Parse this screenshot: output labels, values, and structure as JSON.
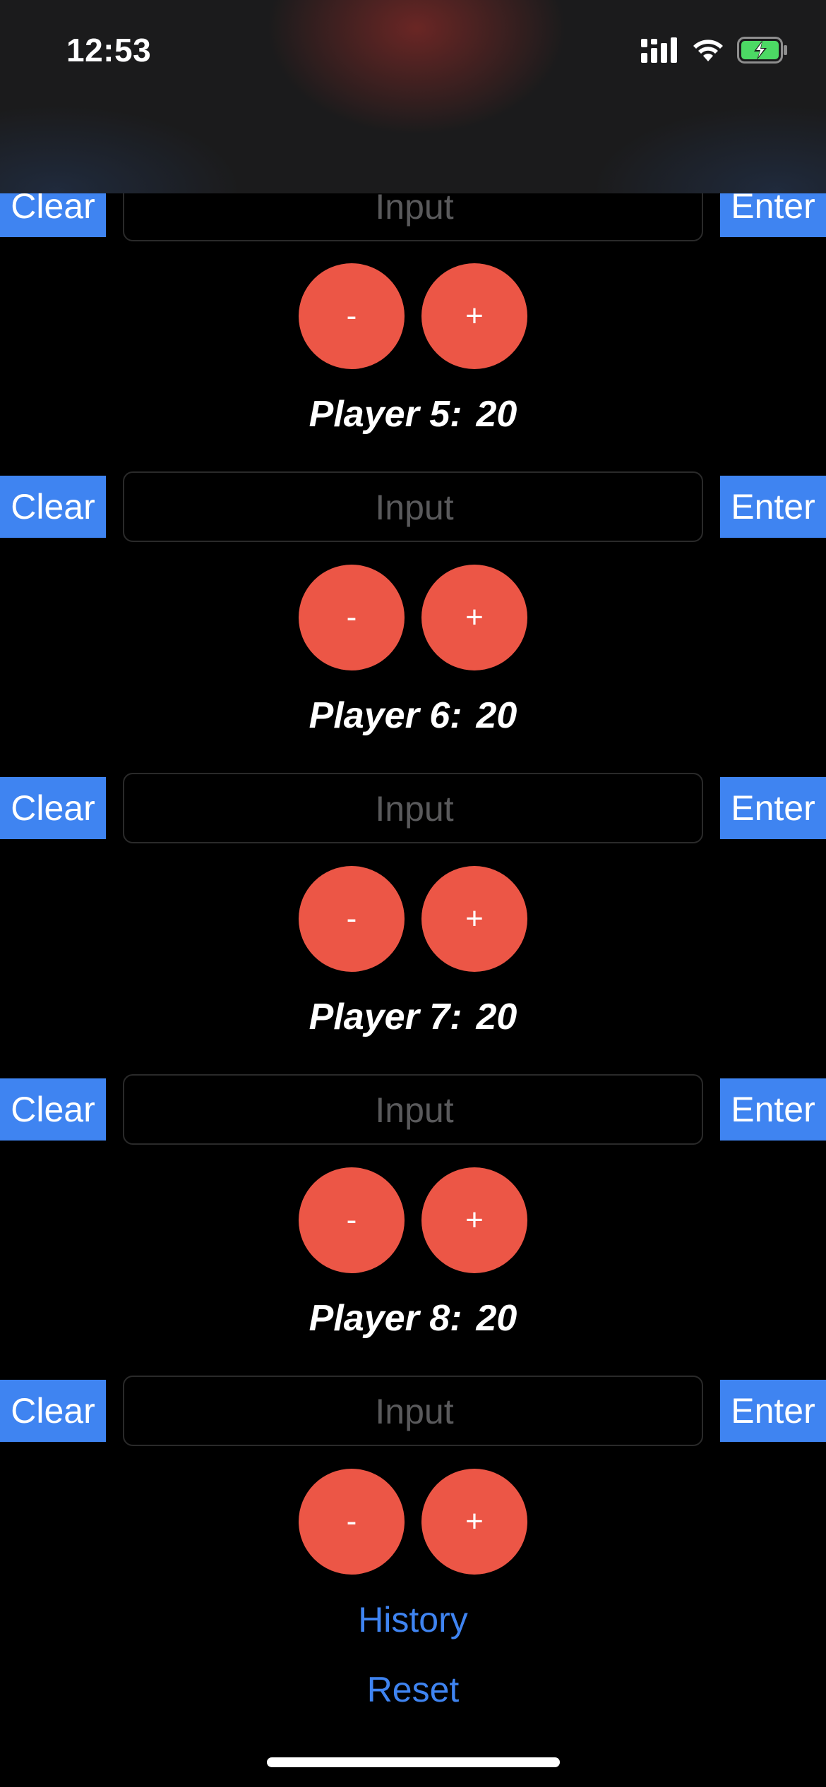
{
  "status_bar": {
    "time": "12:53",
    "icons": [
      "cellular-signal-icon",
      "wifi-icon",
      "battery-charging-icon"
    ],
    "battery_color": "#4cd964"
  },
  "colors": {
    "accent_blue": "#3f84f1",
    "action_red": "#ec5646",
    "background": "#000000"
  },
  "input_placeholder": "Input",
  "clear_label": "Clear",
  "enter_label": "Enter",
  "minus_label": "-",
  "plus_label": "+",
  "players": [
    {
      "label": "Player 5:",
      "score": "20"
    },
    {
      "label": "Player 6:",
      "score": "20"
    },
    {
      "label": "Player 7:",
      "score": "20"
    },
    {
      "label": "Player 8:",
      "score": "20"
    }
  ],
  "footer": {
    "history_label": "History",
    "reset_label": "Reset"
  }
}
